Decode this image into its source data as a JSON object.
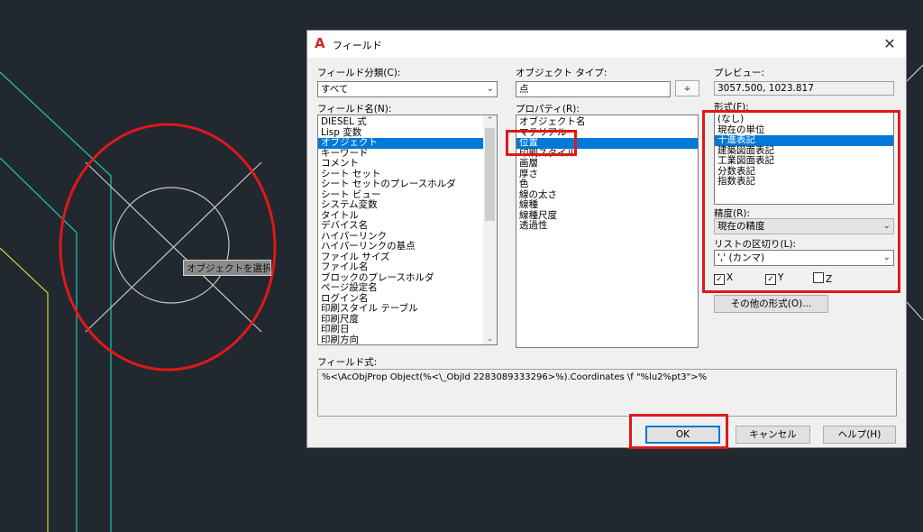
{
  "canvas": {
    "tooltip": "オブジェクトを選択:"
  },
  "dialog": {
    "title": "フィールド",
    "category_label": "フィールド分類(C):",
    "category_value": "すべて",
    "names_label": "フィールド名(N):",
    "names": [
      "DIESEL 式",
      "Lisp 変数",
      "オブジェクト",
      "キーワード",
      "コメント",
      "シート セット",
      "シート セットのプレースホルダ",
      "シート ビュー",
      "システム変数",
      "タイトル",
      "デバイス名",
      "ハイパーリンク",
      "ハイパーリンクの基点",
      "ファイル サイズ",
      "ファイル名",
      "ブロックのプレースホルダ",
      "ページ設定名",
      "ログイン名",
      "印刷スタイル テーブル",
      "印刷尺度",
      "印刷日",
      "印刷方向"
    ],
    "names_selected": 2,
    "object_type_label": "オブジェクト タイプ:",
    "object_type_value": "点",
    "property_label": "プロパティ(R):",
    "properties": [
      "オブジェクト名",
      "マテリアル",
      "位置",
      "印刷スタイル",
      "画層",
      "厚さ",
      "色",
      "線の太さ",
      "線種",
      "線種尺度",
      "透過性"
    ],
    "properties_selected": 2,
    "preview_label": "プレビュー:",
    "preview_value": "3057.500, 1023.817",
    "format_label": "形式(F):",
    "formats": [
      "(なし)",
      "現在の単位",
      "十進表記",
      "建築図面表記",
      "工業図面表記",
      "分数表記",
      "指数表記"
    ],
    "formats_selected": 2,
    "precision_label": "精度(R):",
    "precision_value": "現在の精度",
    "separator_label": "リストの区切り(L):",
    "separator_value": "',' (カンマ)",
    "checkbox_x": "X",
    "checkbox_y": "Y",
    "checkbox_z": "Z",
    "checkbox_x_checked": true,
    "checkbox_y_checked": true,
    "checkbox_z_checked": false,
    "other_format_btn": "その他の形式(O)...",
    "formula_label": "フィールド式:",
    "formula_value": "%<\\AcObjProp Object(%<\\_ObjId 2283089333296>%).Coordinates \\f \"%lu2%pt3\">%",
    "ok": "OK",
    "cancel": "キャンセル",
    "help": "ヘルプ(H)"
  },
  "colors": {
    "highlight": "#e01818",
    "selection": "#0078d7",
    "background": "#212830"
  }
}
